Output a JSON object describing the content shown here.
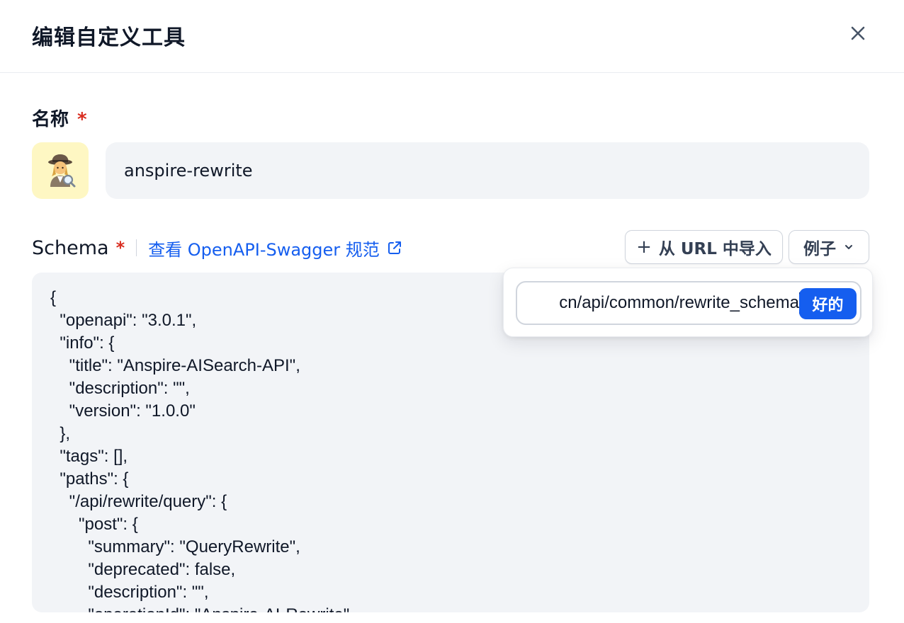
{
  "header": {
    "title": "编辑自定义工具",
    "close_icon": "close-icon"
  },
  "name_field": {
    "label": "名称",
    "required_mark": "*",
    "icon_emoji": "🕵️‍♀️",
    "value": "anspire-rewrite"
  },
  "schema": {
    "label": "Schema",
    "required_mark": "*",
    "doc_link_label": "查看 OpenAPI-Swagger 规范",
    "doc_link_icon": "external-link-icon",
    "import_button_label": "从 URL 中导入",
    "import_button_icon": "plus-icon",
    "example_button_label": "例子",
    "example_button_icon": "chevron-down-icon",
    "code": "{\n  \"openapi\": \"3.0.1\",\n  \"info\": {\n    \"title\": \"Anspire-AISearch-API\",\n    \"description\": \"\",\n    \"version\": \"1.0.0\"\n  },\n  \"tags\": [],\n  \"paths\": {\n    \"/api/rewrite/query\": {\n      \"post\": {\n        \"summary\": \"QueryRewrite\",\n        \"deprecated\": false,\n        \"description\": \"\",\n        \"operationId\": \"Anspire-AI-Rewrite\","
  },
  "import_popover": {
    "url_value": "cn/api/common/rewrite_schema",
    "ok_button_label": "好的"
  },
  "colors": {
    "accent": "#155eef",
    "required": "#d92d20",
    "input_bg": "#f2f4f7",
    "emoji_bg": "#fef7c3"
  }
}
